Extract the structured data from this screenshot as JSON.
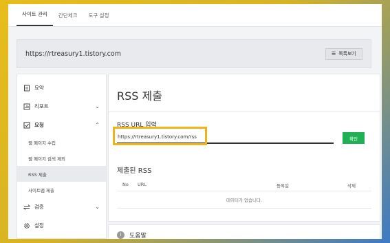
{
  "topnav": {
    "tabs": [
      {
        "label": "사이트 관리",
        "active": true
      },
      {
        "label": "간단체크",
        "active": false
      },
      {
        "label": "도구 설정",
        "active": false
      }
    ]
  },
  "site": {
    "url": "https://rtreasury1.tistory.com",
    "list_button": "목록보기"
  },
  "sidebar": {
    "items": [
      {
        "label": "요약",
        "icon": "summary-icon"
      },
      {
        "label": "리포트",
        "icon": "report-icon"
      },
      {
        "label": "요청",
        "icon": "request-icon"
      },
      {
        "label": "검증",
        "icon": "verify-icon"
      },
      {
        "label": "설정",
        "icon": "gear-icon"
      }
    ],
    "request_sub": [
      {
        "label": "웹 페이지 수집"
      },
      {
        "label": "웹 페이지 검색 제외"
      },
      {
        "label": "RSS 제출"
      },
      {
        "label": "사이트맵 제출"
      }
    ]
  },
  "main": {
    "title": "RSS 제출",
    "input_label": "RSS URL 입력",
    "input_value": "https://rtreasury1.tistory.com/rss",
    "confirm_label": "확인",
    "submitted_title": "제출된 RSS",
    "columns": [
      "No",
      "URL",
      "등록일",
      "삭제"
    ],
    "empty_text": "데이터가 없습니다."
  },
  "help": {
    "title": "도움말"
  },
  "colors": {
    "confirm": "#1fb154",
    "highlight": "#f0b41a"
  }
}
